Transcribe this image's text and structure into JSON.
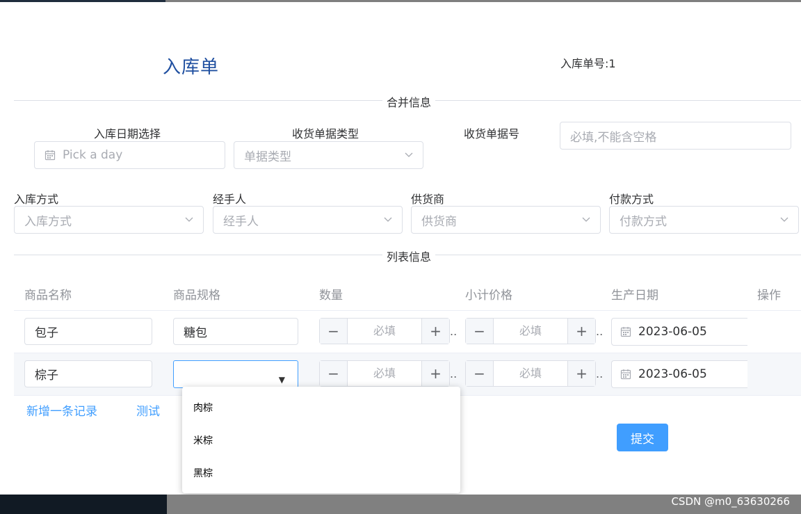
{
  "header": {
    "title": "入库单",
    "order_number": "入库单号:1"
  },
  "sections": {
    "merge_info": "合并信息",
    "list_info": "列表信息"
  },
  "form": {
    "inbound_date": {
      "label": "入库日期选择",
      "placeholder": "Pick a day"
    },
    "receipt_type": {
      "label": "收货单据类型",
      "placeholder": "单据类型"
    },
    "receipt_no": {
      "label": "收货单据号",
      "placeholder": "必填,不能含空格"
    },
    "inbound_method": {
      "label": "入库方式",
      "placeholder": "入库方式"
    },
    "handler": {
      "label": "经手人",
      "placeholder": "经手人"
    },
    "supplier": {
      "label": "供货商",
      "placeholder": "供货商"
    },
    "payment_method": {
      "label": "付款方式",
      "placeholder": "付款方式"
    }
  },
  "table": {
    "columns": [
      "商品名称",
      "商品规格",
      "数量",
      "小计价格",
      "生产日期",
      "操作"
    ],
    "rows": [
      {
        "name": "包子",
        "spec": "糖包",
        "qty_placeholder": "必填",
        "subtotal_placeholder": "必填",
        "date": "2023-06-05"
      },
      {
        "name": "棕子",
        "spec": "",
        "qty_placeholder": "必填",
        "subtotal_placeholder": "必填",
        "date": "2023-06-05"
      }
    ],
    "stepper": {
      "minus": "−",
      "plus": "+"
    },
    "ellipsis": ".."
  },
  "actions": {
    "add_record": "新增一条记录",
    "test": "测试",
    "submit": "提交"
  },
  "spec_dropdown": {
    "options": [
      "肉棕",
      "米棕",
      "黑棕"
    ],
    "arrow": "▼"
  },
  "watermark": "CSDN @m0_63630266",
  "colors": {
    "accent": "#409eff",
    "title": "#1f4fa0"
  }
}
